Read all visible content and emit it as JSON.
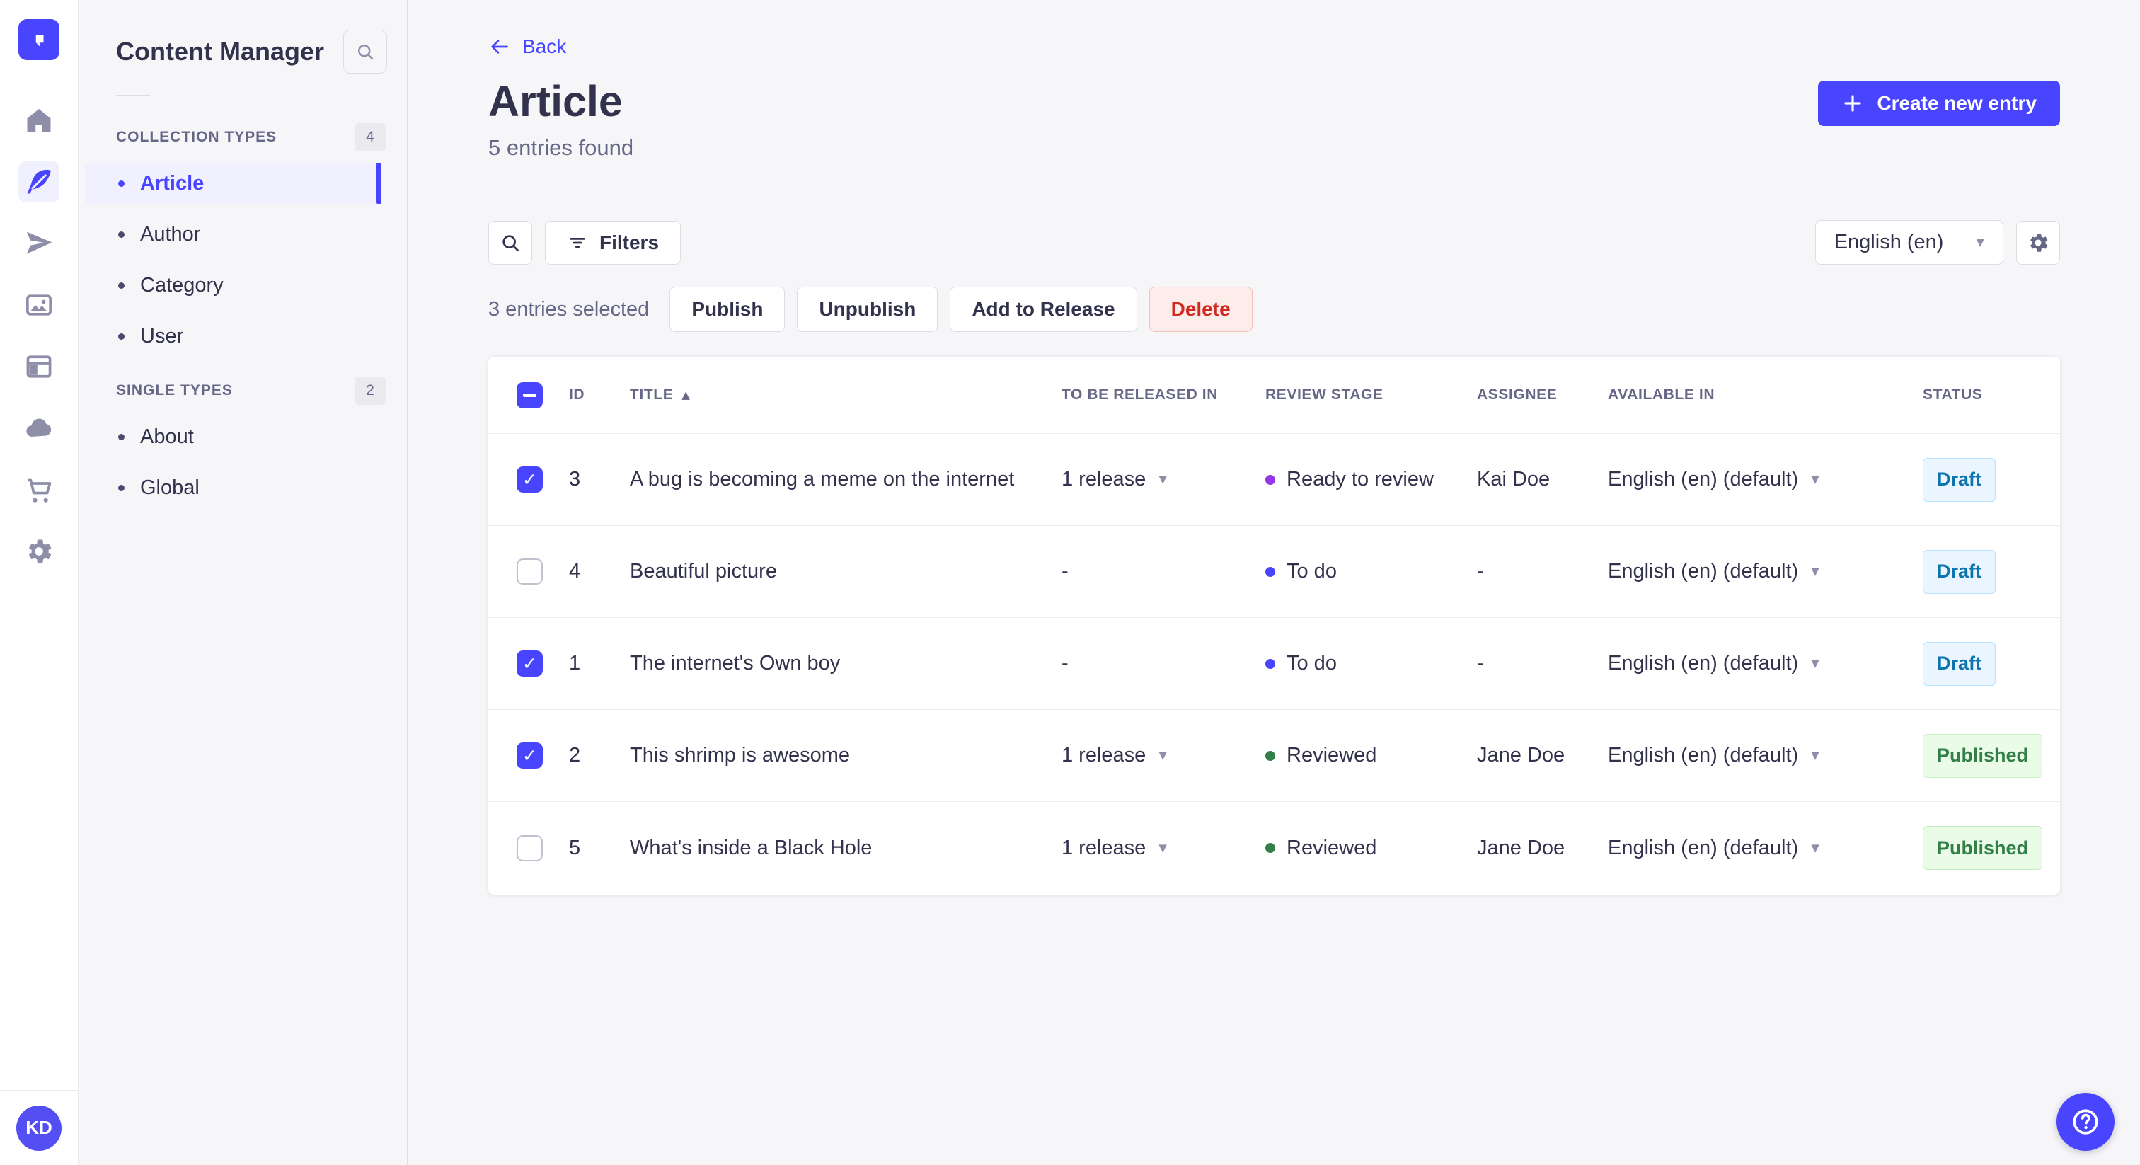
{
  "subnav": {
    "title": "Content Manager",
    "collection_types": {
      "label": "COLLECTION TYPES",
      "count": "4",
      "items": [
        "Article",
        "Author",
        "Category",
        "User"
      ]
    },
    "single_types": {
      "label": "SINGLE TYPES",
      "count": "2",
      "items": [
        "About",
        "Global"
      ]
    },
    "active_item": "Article"
  },
  "header": {
    "back_label": "Back",
    "title": "Article",
    "subtitle": "5 entries found",
    "create_button_label": "Create new entry"
  },
  "toolbar": {
    "filters_label": "Filters",
    "locale_value": "English (en)"
  },
  "selection": {
    "text": "3 entries selected",
    "publish_label": "Publish",
    "unpublish_label": "Unpublish",
    "add_to_release_label": "Add to Release",
    "delete_label": "Delete"
  },
  "table": {
    "headers": [
      "ID",
      "TITLE",
      "TO BE RELEASED IN",
      "REVIEW STAGE",
      "ASSIGNEE",
      "AVAILABLE IN",
      "STATUS"
    ],
    "select_all_state": "indeterminate",
    "rows": [
      {
        "checked": true,
        "id": "3",
        "title": "A bug is becoming a meme on the internet",
        "release": "1 release",
        "stage": "Ready to review",
        "stage_color": "#9736e8",
        "assignee": "Kai Doe",
        "available": "English (en) (default)",
        "status": "Draft"
      },
      {
        "checked": false,
        "id": "4",
        "title": "Beautiful picture",
        "release": "-",
        "stage": "To do",
        "stage_color": "#4945ff",
        "assignee": "-",
        "available": "English (en) (default)",
        "status": "Draft"
      },
      {
        "checked": true,
        "id": "1",
        "title": "The internet's Own boy",
        "release": "-",
        "stage": "To do",
        "stage_color": "#4945ff",
        "assignee": "-",
        "available": "English (en) (default)",
        "status": "Draft"
      },
      {
        "checked": true,
        "id": "2",
        "title": "This shrimp is awesome",
        "release": "1 release",
        "stage": "Reviewed",
        "stage_color": "#328048",
        "assignee": "Jane Doe",
        "available": "English (en) (default)",
        "status": "Published"
      },
      {
        "checked": false,
        "id": "5",
        "title": "What's inside a Black Hole",
        "release": "1 release",
        "stage": "Reviewed",
        "stage_color": "#328048",
        "assignee": "Jane Doe",
        "available": "English (en) (default)",
        "status": "Published"
      }
    ]
  },
  "user": {
    "initials": "KD"
  },
  "icons": {
    "rail": [
      "home-icon",
      "feather-icon",
      "paper-plane-icon",
      "media-library-icon",
      "layout-icon",
      "cloud-icon",
      "cart-icon",
      "gear-icon"
    ],
    "other": [
      "search-icon",
      "filter-icon",
      "plus-icon",
      "chevron-down-icon",
      "back-arrow-icon",
      "help-icon",
      "settings-gear-icon"
    ]
  },
  "colors": {
    "primary": "#4945ff",
    "status_draft_text": "#0c75af",
    "status_draft_bg": "#eaf5ff",
    "status_published_text": "#328048",
    "status_published_bg": "#eafbe7",
    "delete_text": "#d02b20",
    "delete_bg": "#fcecea",
    "stage_todo": "#4945ff",
    "stage_ready_to_review": "#9736e8",
    "stage_reviewed": "#328048"
  }
}
